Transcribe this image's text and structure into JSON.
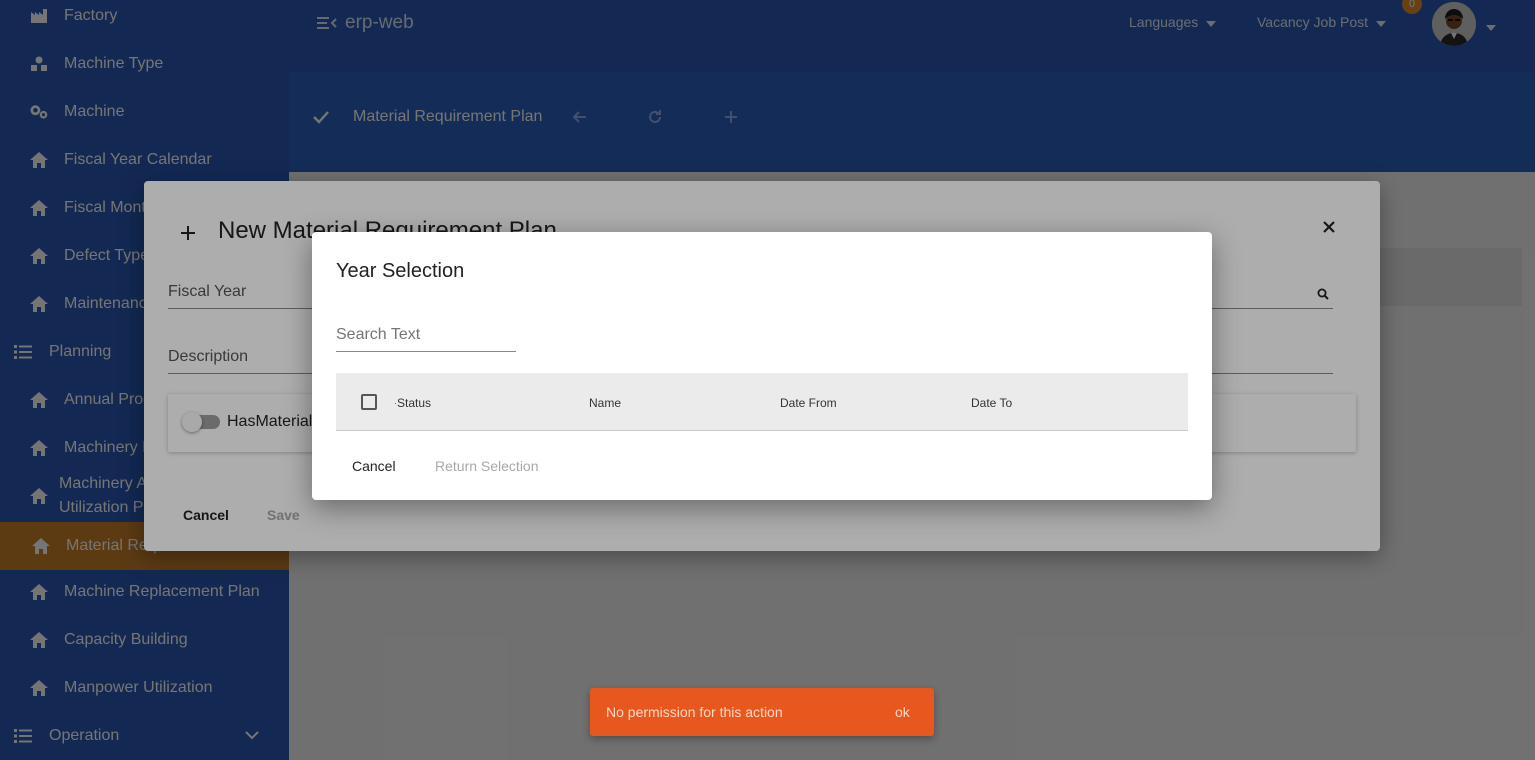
{
  "sidebar": {
    "items": [
      {
        "label": "Factory",
        "icon": "factory-icon"
      },
      {
        "label": "Machine Type",
        "icon": "shapes-icon"
      },
      {
        "label": "Machine",
        "icon": "gears-icon"
      },
      {
        "label": "Fiscal Year Calendar",
        "icon": "home-icon"
      },
      {
        "label": "Fiscal Month",
        "icon": "home-icon"
      },
      {
        "label": "Defect Type",
        "icon": "home-icon"
      },
      {
        "label": "Maintenance",
        "icon": "home-icon"
      },
      {
        "label": "Planning",
        "icon": "list-icon"
      },
      {
        "label": "Annual Production",
        "icon": "home-icon"
      },
      {
        "label": "Machinery Plan",
        "icon": "home-icon"
      },
      {
        "label": "Machinery And",
        "label2": "Utilization Plan",
        "icon": "home-icon"
      },
      {
        "label": "Material Requirement Plan",
        "icon": "home-icon"
      },
      {
        "label": "Machine Replacement Plan",
        "icon": "home-icon"
      },
      {
        "label": "Capacity Building",
        "icon": "home-icon"
      },
      {
        "label": "Manpower Utilization",
        "icon": "home-icon"
      },
      {
        "label": "Operation",
        "icon": "list-icon"
      }
    ]
  },
  "topbar": {
    "app_title": "erp-web",
    "languages": "Languages",
    "vacancy": "Vacancy Job Post",
    "badge_count": "0"
  },
  "subheader": {
    "title": "Material Requirement Plan"
  },
  "outer_modal": {
    "title": "New Material Requirement Plan",
    "fiscal_year_label": "Fiscal Year",
    "description_label": "Description",
    "toggle_label": "HasMaterial",
    "cancel": "Cancel",
    "save": "Save"
  },
  "inner_modal": {
    "title": "Year Selection",
    "search_placeholder": "Search Text",
    "columns": [
      "Status",
      "Name",
      "Date From",
      "Date To"
    ],
    "cancel": "Cancel",
    "return_selection": "Return Selection"
  },
  "snackbar": {
    "message": "No permission for this action",
    "action": "ok"
  },
  "colors": {
    "primary": "#2a5bb5",
    "active_item": "#c9802b",
    "snackbar": "#e8571e",
    "badge": "#e0902a"
  }
}
